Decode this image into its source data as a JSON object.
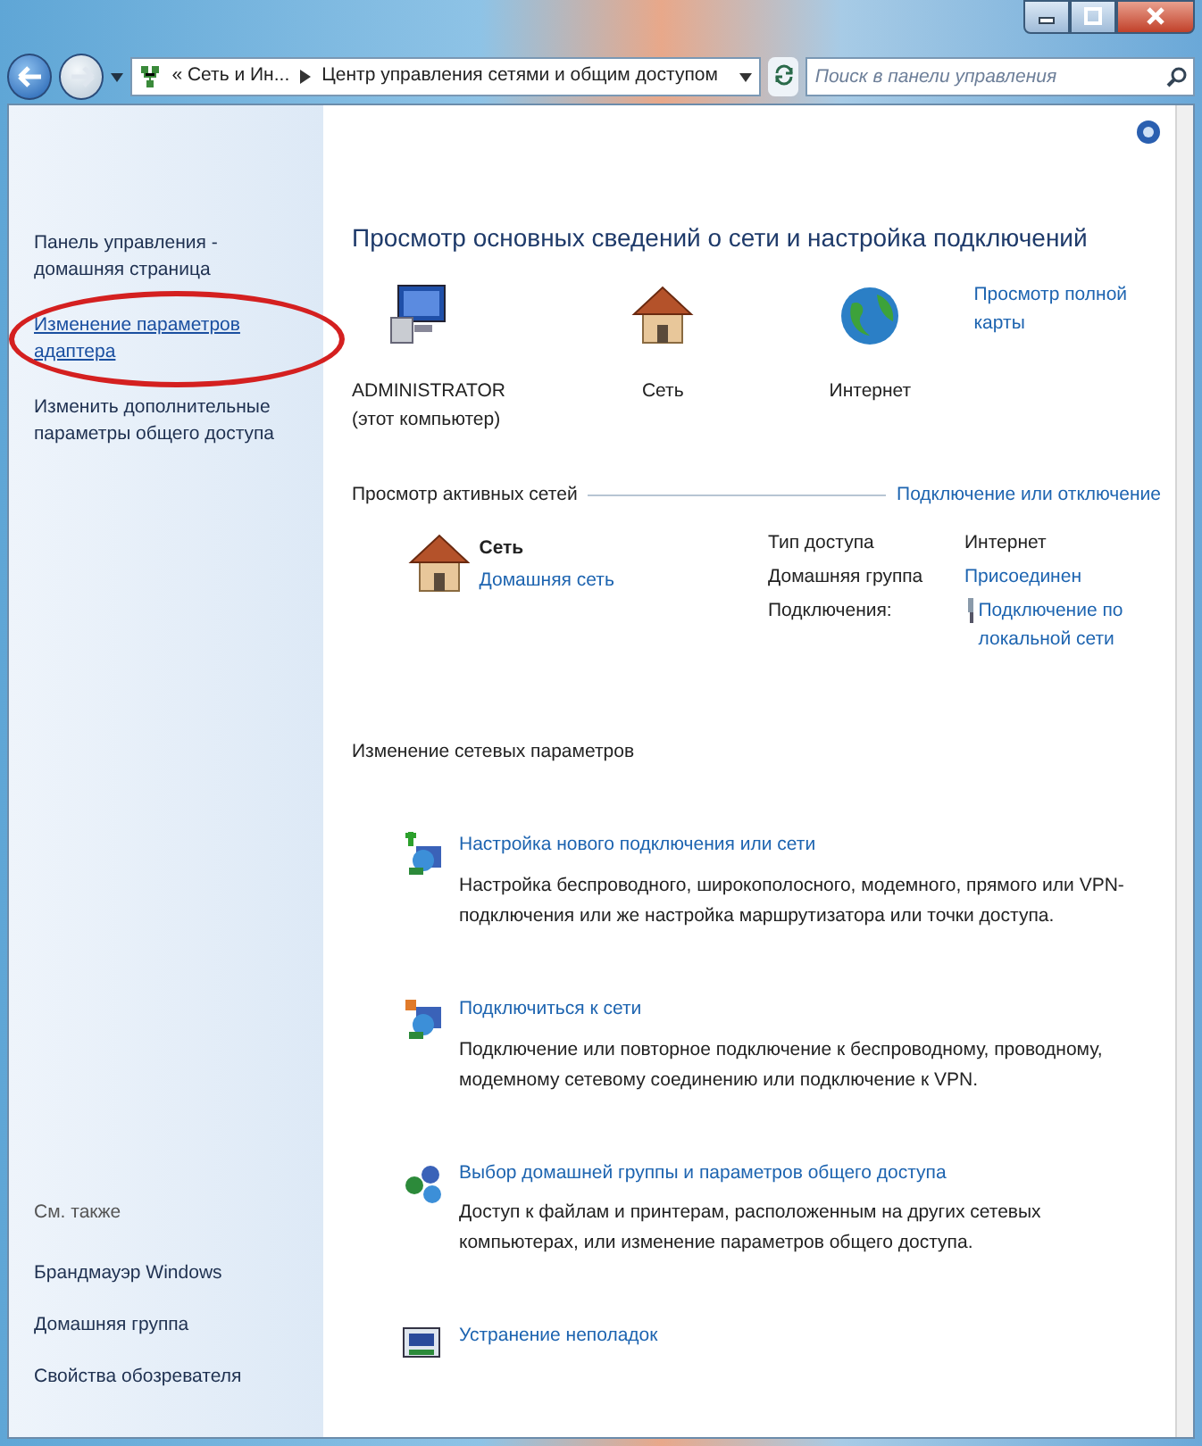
{
  "address_bar": {
    "crumbs": [
      {
        "text": "« Сеть и Ин..."
      },
      {
        "text": "Центр управления сетями и общим доступом"
      }
    ]
  },
  "search": {
    "placeholder": "Поиск в панели управления"
  },
  "sidebar": {
    "items": [
      {
        "text": "Панель управления - домашняя страница",
        "kind": "plain",
        "highlighted": false
      },
      {
        "text": "Изменение параметров адаптера",
        "kind": "link",
        "highlighted": true
      },
      {
        "text": "Изменить дополнительные параметры общего доступа",
        "kind": "plain",
        "highlighted": false
      }
    ],
    "see_also": {
      "title": "См. также",
      "items": [
        {
          "text": "Брандмауэр Windows"
        },
        {
          "text": "Домашняя группа"
        },
        {
          "text": "Свойства обозревателя"
        }
      ]
    }
  },
  "main": {
    "title": "Просмотр основных сведений о сети и настройка подключений",
    "map": {
      "full_map_link": "Просмотр полной карты",
      "nodes": [
        {
          "kind": "computer",
          "name": "ADMINISTRATOR",
          "note": "(этот компьютер)"
        },
        {
          "kind": "house",
          "name": "Сеть"
        },
        {
          "kind": "globe",
          "name": "Интернет"
        }
      ]
    },
    "active_networks": {
      "title": "Просмотр активных сетей",
      "link": "Подключение или отключение",
      "networks": [
        {
          "name": "Сеть",
          "type": "Домашняя сеть",
          "properties": [
            {
              "label": "Тип доступа",
              "value": "Интернет",
              "kind": "text"
            },
            {
              "label": "Домашняя группа",
              "value": "Присоединен",
              "kind": "link"
            },
            {
              "label": "Подключения:",
              "value": "Подключение по локальной сети",
              "kind": "connection"
            }
          ]
        }
      ]
    },
    "change_settings": {
      "title": "Изменение сетевых параметров",
      "tasks": [
        {
          "kind": "new-connection",
          "title": "Настройка нового подключения или сети",
          "description": "Настройка беспроводного, широкополосного, модемного, прямого или VPN-подключения или же настройка маршрутизатора или точки доступа."
        },
        {
          "kind": "connect",
          "title": "Подключиться к сети",
          "description": "Подключение или повторное подключение к беспроводному, проводному, модемному сетевому соединению или подключение к VPN."
        },
        {
          "kind": "homegroup",
          "title": "Выбор домашней группы и параметров общего доступа",
          "description": "Доступ к файлам и принтерам, расположенным на других сетевых компьютерах, или изменение параметров общего доступа."
        },
        {
          "kind": "troubleshoot",
          "title": "Устранение неполадок"
        }
      ]
    }
  }
}
